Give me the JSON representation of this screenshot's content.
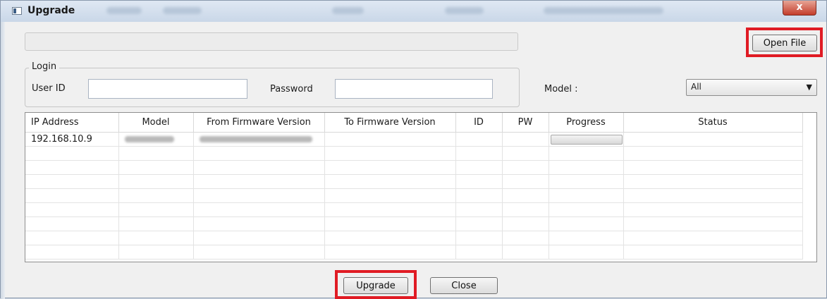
{
  "window": {
    "title": "Upgrade",
    "close_glyph": "x",
    "app_icon": "window-icon"
  },
  "file": {
    "path_value": "",
    "open_file_label": "Open File"
  },
  "login": {
    "legend": "Login",
    "user_id_label": "User ID",
    "user_id_value": "",
    "password_label": "Password",
    "password_value": ""
  },
  "model_filter": {
    "label": "Model :",
    "selected": "All",
    "arrow_icon": "dropdown-arrow-icon"
  },
  "table": {
    "columns": [
      "IP Address",
      "Model",
      "From Firmware Version",
      "To Firmware Version",
      "ID",
      "PW",
      "Progress",
      "Status"
    ],
    "rows": [
      {
        "ip": "192.168.10.9",
        "model": "",
        "from_fw": "",
        "to_fw": "",
        "id": "",
        "pw": "",
        "progress": 0,
        "status": ""
      }
    ]
  },
  "actions": {
    "upgrade_label": "Upgrade",
    "close_label": "Close"
  },
  "colors": {
    "highlight": "#e01b24",
    "close_button": "#c43d2b"
  }
}
